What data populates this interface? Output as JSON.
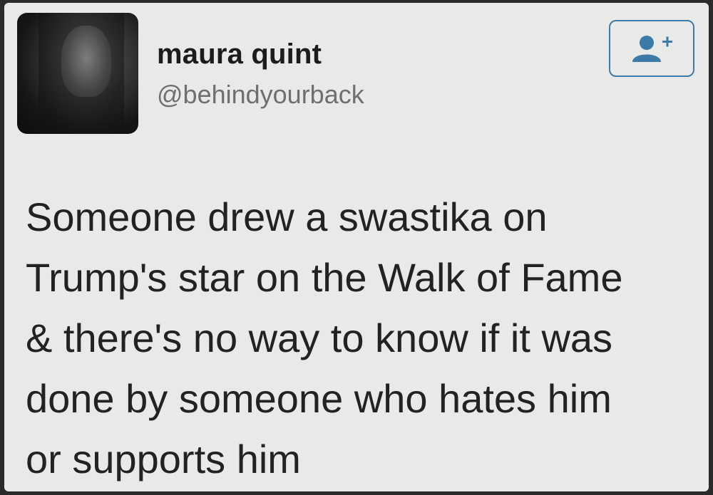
{
  "tweet": {
    "author": {
      "display_name": "maura quint",
      "handle": "@behindyourback",
      "avatar_icon": "profile-photo"
    },
    "follow_button": {
      "icon": "add-user-icon",
      "accent_color": "#3c7aa8"
    },
    "text_lines": [
      "Someone drew a swastika on",
      "Trump's star on the Walk of Fame",
      "& there's no way to know if it was",
      "done by someone who hates him",
      "or supports him"
    ]
  }
}
